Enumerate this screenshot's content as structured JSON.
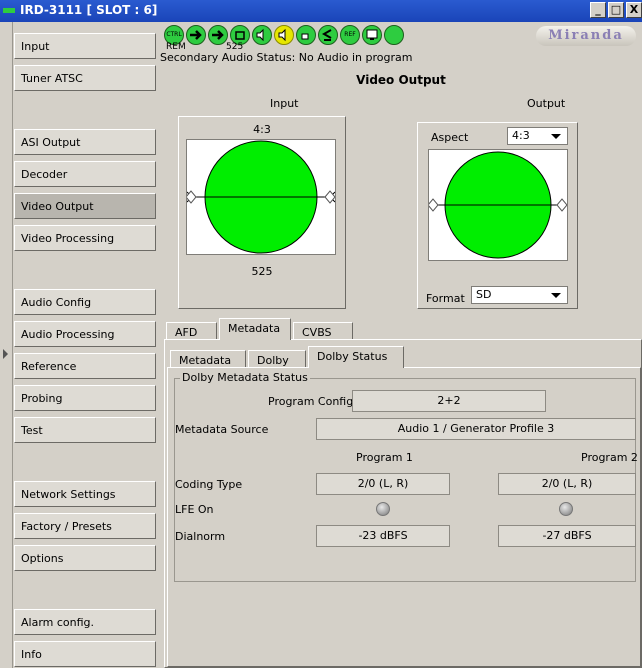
{
  "window": {
    "title": "IRD-3111 [ SLOT : 6]",
    "controls": [
      "_",
      "□",
      "X"
    ]
  },
  "sidebar": {
    "items": [
      {
        "label": "Input"
      },
      {
        "label": "Tuner ATSC"
      },
      {
        "label": "ASI Output"
      },
      {
        "label": "Decoder"
      },
      {
        "label": "Video Output",
        "active": true
      },
      {
        "label": "Video Processing"
      },
      {
        "label": "Audio Config"
      },
      {
        "label": "Audio Processing"
      },
      {
        "label": "Reference"
      },
      {
        "label": "Probing"
      },
      {
        "label": "Test"
      },
      {
        "label": "Network Settings"
      },
      {
        "label": "Factory / Presets"
      },
      {
        "label": "Options"
      },
      {
        "label": "Alarm config."
      },
      {
        "label": "Info"
      }
    ]
  },
  "status_icons": {
    "icons": [
      "ctrl-icon",
      "arrow-right-icon",
      "arrow-right-icon",
      "lock-icon",
      "audio-icon",
      "audio-warning-icon",
      "audio-lock-icon",
      "less-equal-icon",
      "ref-icon",
      "monitor-icon",
      "status-ok-icon"
    ],
    "ctrl_text": "CTRL",
    "ref_text": "REF",
    "rem_label": "REM",
    "count_label": "525",
    "logo": "Miranda"
  },
  "status_line": "Secondary Audio Status: No Audio in program",
  "video_output": {
    "title": "Video Output",
    "input_label": "Input",
    "output_label": "Output",
    "input_aspect": "4:3",
    "input_lines": "525",
    "aspect_label": "Aspect",
    "aspect_value": "4:3",
    "format_label": "Format",
    "format_value": "SD",
    "colors": {
      "circle": "#00ee00"
    }
  },
  "tabs": {
    "main": [
      "AFD",
      "Metadata",
      "CVBS"
    ],
    "main_active": "Metadata",
    "sub": [
      "Metadata",
      "Dolby",
      "Dolby Status"
    ],
    "sub_active": "Dolby Status"
  },
  "dolby_status": {
    "group_title": "Dolby Metadata Status",
    "program_config_label": "Program Config",
    "program_config_value": "2+2",
    "metadata_source_label": "Metadata Source",
    "metadata_source_value": "Audio 1 / Generator Profile 3",
    "program1_label": "Program 1",
    "program2_label": "Program 2",
    "coding_type_label": "Coding Type",
    "coding_type_p1": "2/0 (L, R)",
    "coding_type_p2": "2/0 (L, R)",
    "lfe_label": "LFE On",
    "dialnorm_label": "Dialnorm",
    "dialnorm_p1": "-23 dBFS",
    "dialnorm_p2": "-27 dBFS"
  }
}
